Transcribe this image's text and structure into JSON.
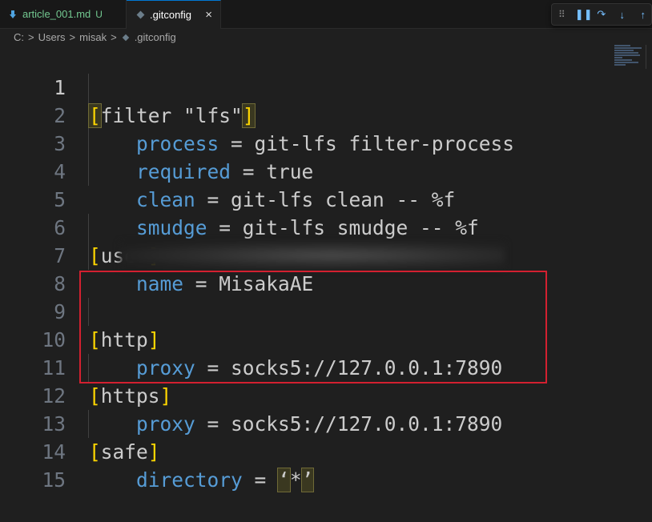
{
  "tabs": [
    {
      "label": "article_001.md",
      "badge": "U",
      "icon": "markdown-download-icon",
      "active": false
    },
    {
      "label": ".gitconfig",
      "icon": "gitconfig-icon",
      "active": true,
      "close": "×"
    }
  ],
  "debug_toolbar": {
    "grip": "⠿",
    "pause": "❚❚",
    "step_over": "↷",
    "step_into": "↓",
    "step_out": "↑"
  },
  "breadcrumb": {
    "segments": [
      "C:",
      "Users",
      "misak",
      ".gitconfig"
    ],
    "separator": ">"
  },
  "editor": {
    "lines": [
      {
        "n": "1"
      },
      {
        "n": "2"
      },
      {
        "n": "3"
      },
      {
        "n": "4"
      },
      {
        "n": "5"
      },
      {
        "n": "6"
      },
      {
        "n": "7"
      },
      {
        "n": "8"
      },
      {
        "n": "9"
      },
      {
        "n": "10"
      },
      {
        "n": "11"
      },
      {
        "n": "12"
      },
      {
        "n": "13"
      },
      {
        "n": "14"
      },
      {
        "n": "15"
      }
    ],
    "code": {
      "l1_section": "filter \"lfs\"",
      "l2_key": "process",
      "l2_val": "git-lfs filter-process",
      "l3_key": "required",
      "l3_val": "true",
      "l4_key": "clean",
      "l4_val": "git-lfs clean -- %f",
      "l5_key": "smudge",
      "l5_val": "git-lfs smudge -- %f",
      "l6_section": "user",
      "l7_key": "name",
      "l7_val": "MisakaAE",
      "l9_section": "http",
      "l10_key": "proxy",
      "l10_val": "socks5://127.0.0.1:7890",
      "l11_section": "https",
      "l12_key": "proxy",
      "l12_val": "socks5://127.0.0.1:7890",
      "l13_section": "safe",
      "l14_key": "directory",
      "l14_q1": "‘",
      "l14_val": "*",
      "l14_q2": "’",
      "eq": " = ",
      "open": "[",
      "close": "]"
    }
  },
  "colors": {
    "keyword": "#569cd6",
    "bracket": "#ffd700",
    "highlight_box": "#d32030",
    "active_tab_border": "#0078d4",
    "untracked": "#73c991"
  }
}
